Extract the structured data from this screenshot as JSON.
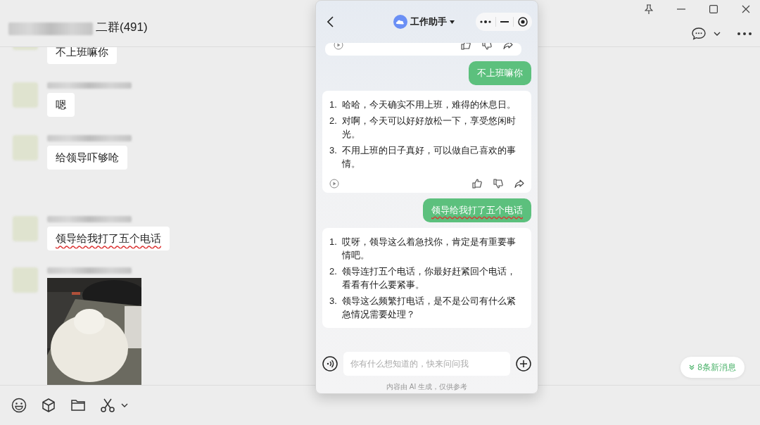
{
  "chat": {
    "title": "二群(491)",
    "messages": [
      {
        "kind": "text",
        "text": "不上班嘛你",
        "spellcheck": false
      },
      {
        "kind": "text",
        "text": "嗯",
        "spellcheck": false
      },
      {
        "kind": "text",
        "text": "给领导吓够呛",
        "spellcheck": false
      },
      {
        "kind": "text",
        "text": "领导给我打了五个电话",
        "spellcheck": true
      },
      {
        "kind": "picture"
      }
    ],
    "new_messages": "8条新消息"
  },
  "assistant": {
    "title": "工作助手",
    "messages": [
      {
        "kind": "cut"
      },
      {
        "kind": "user",
        "text": "不上班嘛你",
        "spellcheck": false
      },
      {
        "kind": "ai",
        "items": [
          {
            "marker": "1.",
            "text": "哈哈，今天确实不用上班，难得的休息日。"
          },
          {
            "marker": "2.",
            "text": "对啊，今天可以好好放松一下，享受悠闲时光。"
          },
          {
            "marker": "3.",
            "text": "不用上班的日子真好，可以做自己喜欢的事情。"
          }
        ],
        "actions": true
      },
      {
        "kind": "user",
        "text": "领导给我打了五个电话",
        "spellcheck": true
      },
      {
        "kind": "ai",
        "items": [
          {
            "marker": "1.",
            "text": "哎呀，领导这么着急找你，肯定是有重要事情吧。"
          },
          {
            "marker": "2.",
            "text": "领导连打五个电话，你最好赶紧回个电话，看看有什么要紧事。"
          },
          {
            "marker": "3.",
            "text": "领导这么频繁打电话，是不是公司有什么紧急情况需要处理？"
          }
        ],
        "actions": false
      }
    ],
    "input": {
      "placeholder": "你有什么想知道的，快来问问我"
    },
    "disclaimer": "内容由 AI 生成，仅供参考"
  }
}
